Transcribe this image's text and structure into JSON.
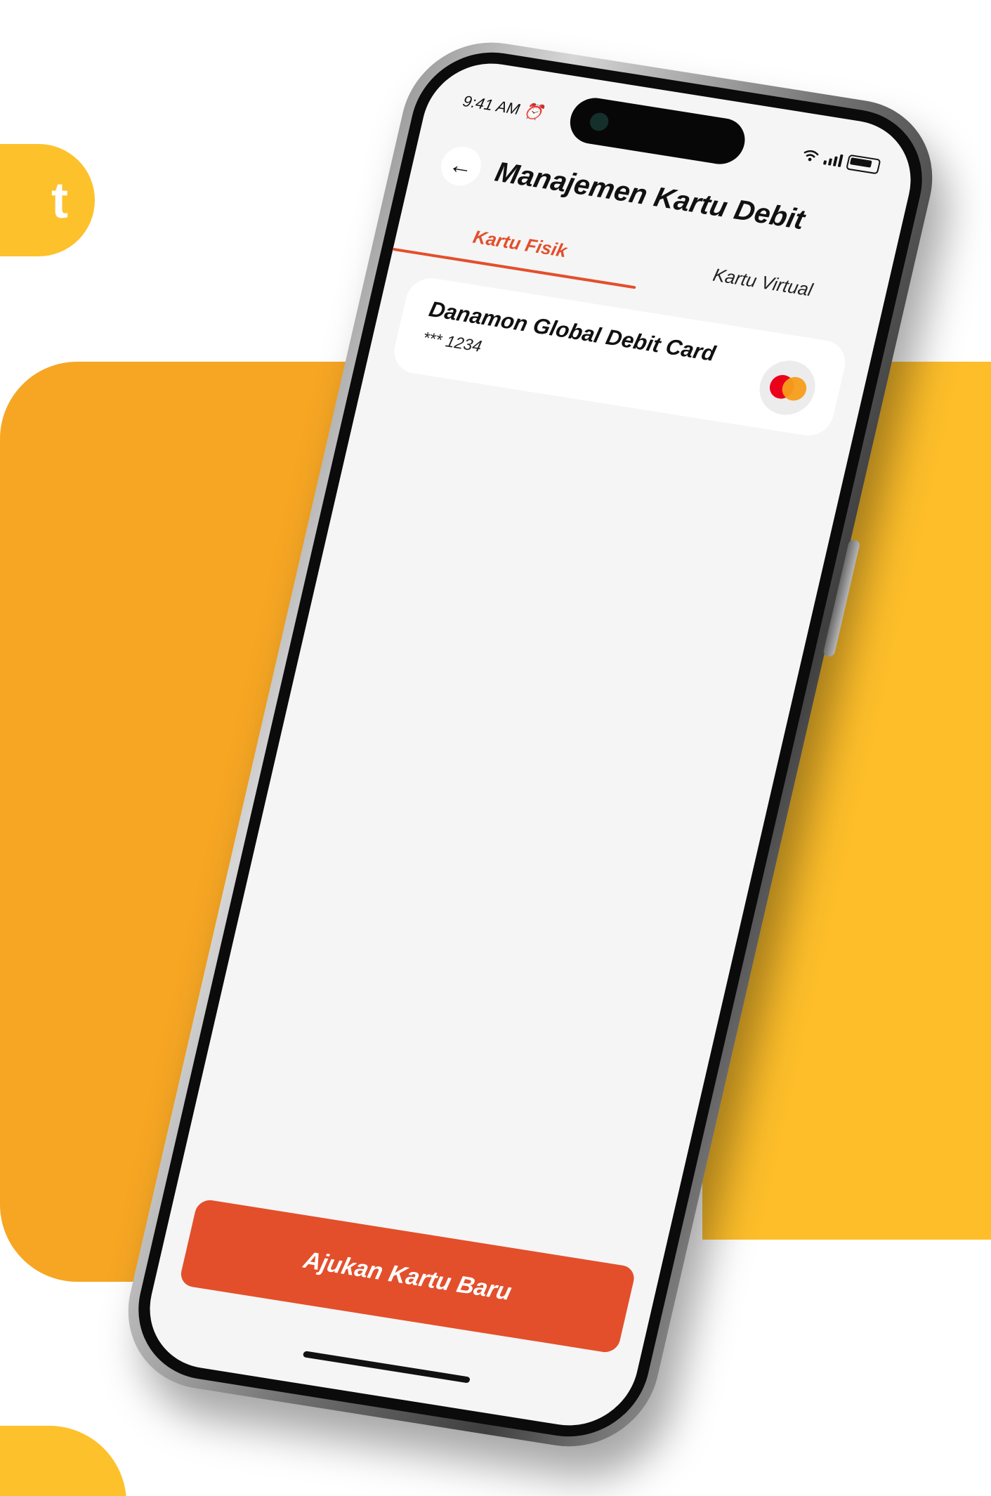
{
  "background": {
    "top_pill_text": "t"
  },
  "status_bar": {
    "time": "9:41 AM",
    "alarm_icon": "alarm-clock-icon",
    "wifi_icon": "wifi-icon",
    "signal_icon": "cellular-signal-icon",
    "battery_icon": "battery-icon"
  },
  "header": {
    "back_icon": "arrow-left-icon",
    "title": "Manajemen Kartu Debit"
  },
  "tabs": [
    {
      "label": "Kartu Fisik",
      "active": true
    },
    {
      "label": "Kartu Virtual",
      "active": false
    }
  ],
  "card": {
    "name": "Danamon Global Debit Card",
    "number": "*** 1234",
    "network_icon": "mastercard-logo-icon"
  },
  "cta": {
    "label": "Ajukan Kartu Baru"
  },
  "colors": {
    "accent": "#E34F2B",
    "background_yellow": "#FDC12B",
    "background_orange": "#F6A623",
    "screen_bg": "#F5F5F5"
  }
}
